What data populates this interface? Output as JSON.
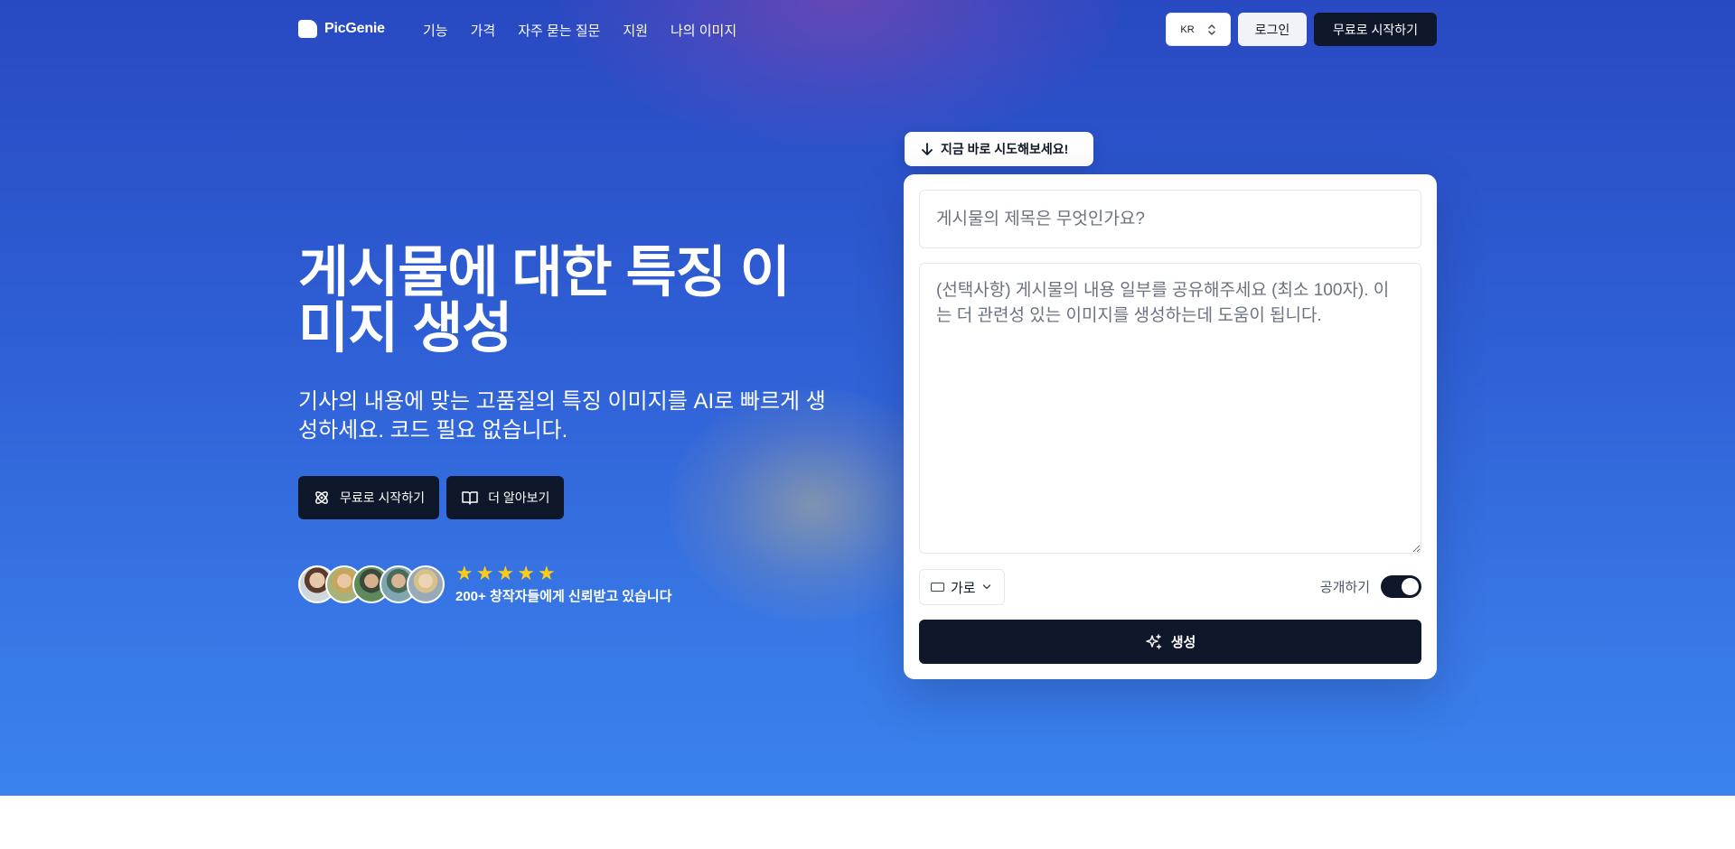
{
  "brand": {
    "name": "PicGenie"
  },
  "nav": {
    "links": [
      "기능",
      "가격",
      "자주 묻는 질문",
      "지원",
      "나의 이미지"
    ],
    "language": "KR",
    "login_label": "로그인",
    "start_label": "무료로 시작하기"
  },
  "hero": {
    "headline": "게시물에 대한 특징 이미지 생성",
    "subhead": "기사의 내용에 맞는 고품질의 특징 이미지를 AI로 빠르게 생성하세요. 코드 필요 없습니다.",
    "cta_primary": "무료로 시작하기",
    "cta_secondary": "더 알아보기",
    "rating_stars": 5,
    "trust_label": "200+ 창작자들에게 신뢰받고 있습니다"
  },
  "generator": {
    "badge": "지금 바로 시도해보세요!",
    "title_placeholder": "게시물의 제목은 무엇인가요?",
    "content_placeholder": "(선택사항) 게시물의 내용 일부를 공유해주세요 (최소 100자). 이는 더 관련성 있는 이미지를 생성하는데 도움이 됩니다.",
    "aspect_label": "가로",
    "public_label": "공개하기",
    "public_enabled": true,
    "generate_label": "생성"
  },
  "colors": {
    "hero_top": "#2849c2",
    "hero_bottom": "#3a82ee",
    "dark_button": "#0f172a",
    "star": "#facc15"
  }
}
